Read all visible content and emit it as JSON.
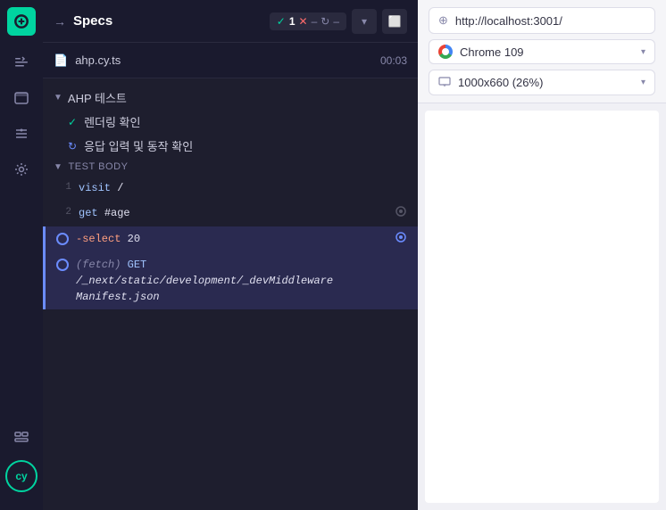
{
  "sidebar": {
    "logo_label": "cy",
    "items": [
      {
        "name": "specs-icon",
        "icon": "≡",
        "label": "Specs",
        "active": false
      },
      {
        "name": "browser-icon",
        "icon": "⬜",
        "label": "Browser",
        "active": false
      },
      {
        "name": "selector-icon",
        "icon": "✂",
        "label": "Selector",
        "active": false
      },
      {
        "name": "settings-icon",
        "icon": "⚙",
        "label": "Settings",
        "active": false
      }
    ],
    "bottom_items": [
      {
        "name": "shortcut-icon",
        "icon": "⌘",
        "label": "Shortcuts"
      }
    ]
  },
  "header": {
    "title": "Specs",
    "icon": "→",
    "status": {
      "check_count": "1",
      "cross_label": "✕",
      "spin_label": "↻",
      "dash_label": "–"
    }
  },
  "file": {
    "name": "ahp.cy.ts",
    "time": "00:03"
  },
  "tests": {
    "suite_label": "AHP 테스트",
    "items": [
      {
        "status": "pass",
        "label": "렌더링 확인"
      },
      {
        "status": "spin",
        "label": "응답 입력 및 동작 확인"
      }
    ]
  },
  "commands": {
    "section_label": "TEST BODY",
    "rows": [
      {
        "num": "1",
        "type": "text",
        "text": "visit /",
        "active": false
      },
      {
        "num": "2",
        "type": "text",
        "text": "get  #age",
        "active": false,
        "has_action": true
      },
      {
        "num": "",
        "type": "circle",
        "text": "-select  20",
        "active": true,
        "has_action": true
      },
      {
        "num": "",
        "type": "circle",
        "text_line1": "(fetch)    GET",
        "text_line2": "/_next/static/development/_devMiddleware",
        "text_line3": "Manifest.json",
        "active": true,
        "multiline": true
      }
    ]
  },
  "browser": {
    "url": "http://localhost:3001/",
    "name": "Chrome 109",
    "viewport": "1000x660 (26%)"
  },
  "icons": {
    "url_icon": "⊕",
    "viewport_icon": "📊",
    "link_icon": "⌀"
  }
}
